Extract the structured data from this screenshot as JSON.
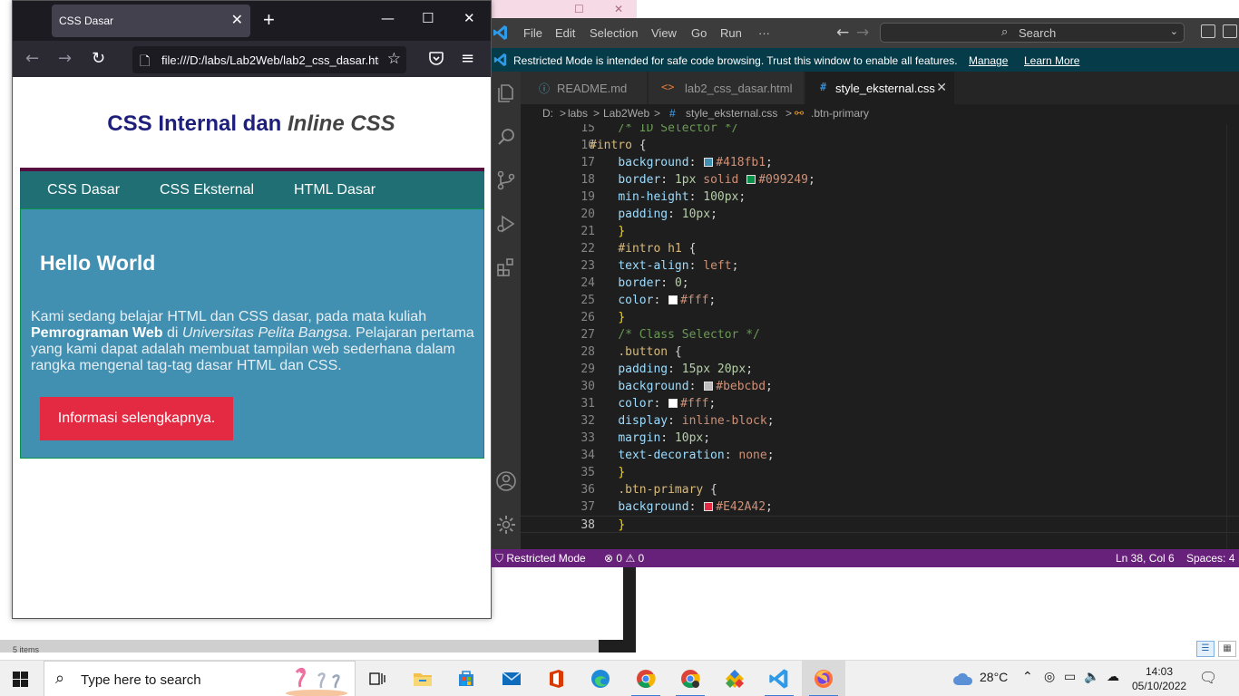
{
  "firefox": {
    "tab_title": "CSS Dasar",
    "tab_close": "✕",
    "new_tab": "+",
    "url": "file:///D:/labs/Lab2Web/lab2_css_dasar.html",
    "window_controls": {
      "minimize": "—",
      "maximize": "☐",
      "close": "✕"
    },
    "nav_icons": {
      "back": "back-arrow-icon",
      "forward": "forward-arrow-icon",
      "reload": "reload-icon",
      "page": "page-icon",
      "bookmark": "star-icon",
      "pocket": "pocket-icon",
      "menu": "hamburger-menu-icon"
    }
  },
  "page": {
    "title_plain": "CSS Internal dan ",
    "title_italic": "Inline CSS",
    "nav": [
      "CSS Dasar",
      "CSS Eksternal",
      "HTML Dasar"
    ],
    "heading": "Hello World",
    "para_1": "Kami sedang belajar HTML dan CSS dasar, pada mata kuliah ",
    "para_bold": "Pemrograman Web",
    "para_2": " di ",
    "para_italic": "Universitas Pelita Bangsa",
    "para_3": ". Pelajaran pertama yang kami dapat adalah membuat tampilan web sederhana dalam rangka mengenal tag-tag dasar HTML dan CSS.",
    "button": "Informasi selengkapnya.",
    "colors": {
      "title": "#1e1e7c",
      "nav_bg": "#1f6f75",
      "nav_border": "#560e40",
      "intro_bg": "#418fb1",
      "intro_border": "#099249",
      "button_bg": "#E42A42"
    }
  },
  "vscode": {
    "menu": [
      "File",
      "Edit",
      "Selection",
      "View",
      "Go",
      "Run",
      "···"
    ],
    "search": "Search",
    "banner": {
      "text": "Restricted Mode is intended for safe code browsing. Trust this window to enable all features.",
      "manage": "Manage",
      "learn_more": "Learn More"
    },
    "tabs": [
      {
        "icon": "ⓘ",
        "label": "README.md",
        "active": false
      },
      {
        "icon": "<>",
        "label": "lab2_css_dasar.html",
        "active": false
      },
      {
        "icon": "#",
        "label": "style_eksternal.css",
        "active": true
      }
    ],
    "breadcrumb": [
      "D:",
      "labs",
      "Lab2Web",
      "style_eksternal.css",
      ".btn-primary"
    ],
    "breadcrumb_sep": ">",
    "status": {
      "mode": "Restricted Mode",
      "errors": "0",
      "warnings": "0",
      "position": "Ln 38, Col 6",
      "spaces": "Spaces: 4"
    },
    "colors": {
      "banner": "#063b49",
      "status_bar": "#68217a",
      "editor_bg": "#1e1e1e"
    }
  },
  "code": [
    {
      "n": "15",
      "tokens": [
        [
          "i",
          "    "
        ],
        [
          "com",
          "/* ID Selector */"
        ]
      ]
    },
    {
      "n": "16",
      "tokens": [
        [
          "sel",
          "#intro"
        ],
        [
          "br",
          " {"
        ]
      ]
    },
    {
      "n": "17",
      "tokens": [
        [
          "i",
          "    "
        ],
        [
          "prop",
          "background"
        ],
        [
          "br",
          ": "
        ],
        [
          "sw",
          "#418fb1"
        ],
        [
          "str",
          "#418fb1"
        ],
        [
          "br",
          ";"
        ]
      ]
    },
    {
      "n": "18",
      "tokens": [
        [
          "i",
          "    "
        ],
        [
          "prop",
          "border"
        ],
        [
          "br",
          ": "
        ],
        [
          "num",
          "1px"
        ],
        [
          "str",
          " solid "
        ],
        [
          "sw",
          "#099249"
        ],
        [
          "str",
          "#099249"
        ],
        [
          "br",
          ";"
        ]
      ]
    },
    {
      "n": "19",
      "tokens": [
        [
          "i",
          "    "
        ],
        [
          "prop",
          "min-height"
        ],
        [
          "br",
          ": "
        ],
        [
          "num",
          "100px"
        ],
        [
          "br",
          ";"
        ]
      ]
    },
    {
      "n": "20",
      "tokens": [
        [
          "i",
          "    "
        ],
        [
          "prop",
          "padding"
        ],
        [
          "br",
          ": "
        ],
        [
          "num",
          "10px"
        ],
        [
          "br",
          ";"
        ]
      ]
    },
    {
      "n": "21",
      "tokens": [
        [
          "i",
          "    "
        ],
        [
          "yel",
          "}"
        ]
      ]
    },
    {
      "n": "22",
      "tokens": [
        [
          "i",
          "    "
        ],
        [
          "sel",
          "#intro h1"
        ],
        [
          "br",
          " {"
        ]
      ]
    },
    {
      "n": "23",
      "tokens": [
        [
          "i",
          "    "
        ],
        [
          "prop",
          "text-align"
        ],
        [
          "br",
          ": "
        ],
        [
          "str",
          "left"
        ],
        [
          "br",
          ";"
        ]
      ]
    },
    {
      "n": "24",
      "tokens": [
        [
          "i",
          "    "
        ],
        [
          "prop",
          "border"
        ],
        [
          "br",
          ": "
        ],
        [
          "num",
          "0"
        ],
        [
          "br",
          ";"
        ]
      ]
    },
    {
      "n": "25",
      "tokens": [
        [
          "i",
          "    "
        ],
        [
          "prop",
          "color"
        ],
        [
          "br",
          ": "
        ],
        [
          "sw",
          "#fff"
        ],
        [
          "str",
          "#fff"
        ],
        [
          "br",
          ";"
        ]
      ]
    },
    {
      "n": "26",
      "tokens": [
        [
          "i",
          "    "
        ],
        [
          "yel",
          "}"
        ]
      ]
    },
    {
      "n": "27",
      "tokens": [
        [
          "i",
          "    "
        ],
        [
          "com",
          "/* Class Selector */"
        ]
      ]
    },
    {
      "n": "28",
      "tokens": [
        [
          "i",
          "    "
        ],
        [
          "sel",
          ".button"
        ],
        [
          "br",
          " {"
        ]
      ]
    },
    {
      "n": "29",
      "tokens": [
        [
          "i",
          "    "
        ],
        [
          "prop",
          "padding"
        ],
        [
          "br",
          ": "
        ],
        [
          "num",
          "15px 20px"
        ],
        [
          "br",
          ";"
        ]
      ]
    },
    {
      "n": "30",
      "tokens": [
        [
          "i",
          "    "
        ],
        [
          "prop",
          "background"
        ],
        [
          "br",
          ": "
        ],
        [
          "sw",
          "#bebcbd"
        ],
        [
          "str",
          "#bebcbd"
        ],
        [
          "br",
          ";"
        ]
      ]
    },
    {
      "n": "31",
      "tokens": [
        [
          "i",
          "    "
        ],
        [
          "prop",
          "color"
        ],
        [
          "br",
          ": "
        ],
        [
          "sw",
          "#fff"
        ],
        [
          "str",
          "#fff"
        ],
        [
          "br",
          ";"
        ]
      ]
    },
    {
      "n": "32",
      "tokens": [
        [
          "i",
          "    "
        ],
        [
          "prop",
          "display"
        ],
        [
          "br",
          ": "
        ],
        [
          "str",
          "inline-block"
        ],
        [
          "br",
          ";"
        ]
      ]
    },
    {
      "n": "33",
      "tokens": [
        [
          "i",
          "    "
        ],
        [
          "prop",
          "margin"
        ],
        [
          "br",
          ": "
        ],
        [
          "num",
          "10px"
        ],
        [
          "br",
          ";"
        ]
      ]
    },
    {
      "n": "34",
      "tokens": [
        [
          "i",
          "    "
        ],
        [
          "prop",
          "text-decoration"
        ],
        [
          "br",
          ": "
        ],
        [
          "str",
          "none"
        ],
        [
          "br",
          ";"
        ]
      ]
    },
    {
      "n": "35",
      "tokens": [
        [
          "i",
          "    "
        ],
        [
          "yel",
          "}"
        ]
      ]
    },
    {
      "n": "36",
      "tokens": [
        [
          "i",
          "    "
        ],
        [
          "sel",
          ".btn-primary"
        ],
        [
          "br",
          " {"
        ]
      ]
    },
    {
      "n": "37",
      "tokens": [
        [
          "i",
          "    "
        ],
        [
          "prop",
          "background"
        ],
        [
          "br",
          ": "
        ],
        [
          "sw",
          "#E42A42"
        ],
        [
          "str",
          "#E42A42"
        ],
        [
          "br",
          ";"
        ]
      ]
    },
    {
      "n": "38",
      "tokens": [
        [
          "i",
          "    "
        ],
        [
          "yel",
          "}"
        ]
      ],
      "current": true
    }
  ],
  "taskbar": {
    "search_placeholder": "Type here to search",
    "weather": "28°C",
    "time": "14:03",
    "date": "05/10/2022",
    "apps": [
      "task-view-icon",
      "file-explorer-icon",
      "microsoft-store-icon",
      "mail-icon",
      "office-icon",
      "edge-icon",
      "chrome-icon",
      "chrome-profile-icon",
      "git-icon",
      "vscode-icon",
      "firefox-icon"
    ]
  },
  "background": {
    "items_label": "5 items",
    "window_controls": "— ☐ ✕"
  }
}
